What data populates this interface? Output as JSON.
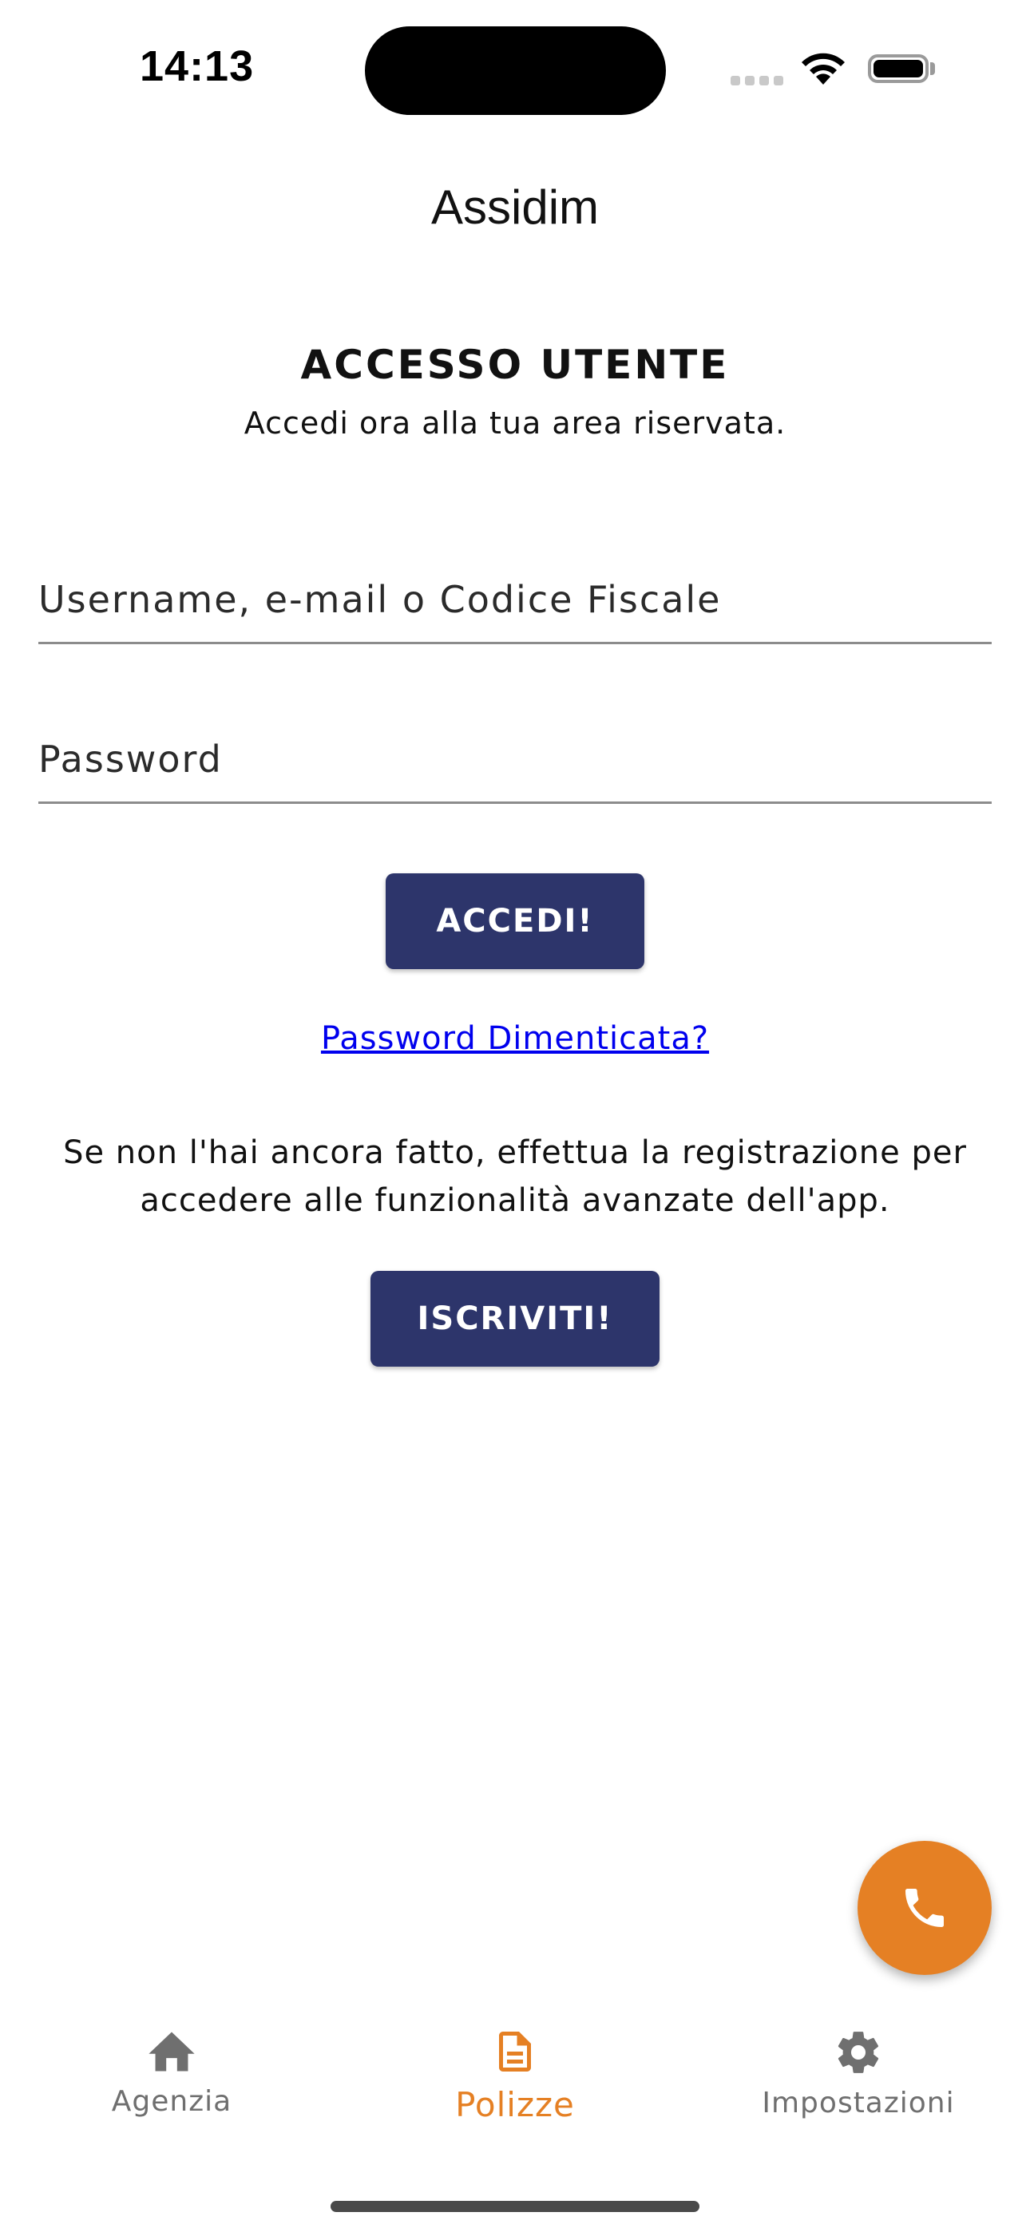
{
  "status_bar": {
    "time": "14:13"
  },
  "app": {
    "title": "Assidim"
  },
  "login": {
    "heading": "ACCESSO UTENTE",
    "subheading": "Accedi ora alla tua area riservata.",
    "username_placeholder": "Username, e-mail o Codice Fiscale",
    "password_placeholder": "Password",
    "login_button": "ACCEDI!",
    "forgot_link": "Password Dimenticata?",
    "register_info": "Se non l'hai ancora fatto, effettua la registrazione per accedere alle funzionalità avanzate dell'app.",
    "register_button": "ISCRIVITI!"
  },
  "fab": {
    "icon": "phone-icon"
  },
  "bottom_nav": {
    "items": [
      {
        "label": "Agenzia",
        "icon": "home-icon",
        "active": false
      },
      {
        "label": "Polizze",
        "icon": "document-icon",
        "active": true
      },
      {
        "label": "Impostazioni",
        "icon": "gear-icon",
        "active": false
      }
    ]
  },
  "colors": {
    "primary_button": "#2d356b",
    "accent": "#e58024",
    "link": "#0000ee",
    "inactive_nav": "#6f6f6f"
  }
}
